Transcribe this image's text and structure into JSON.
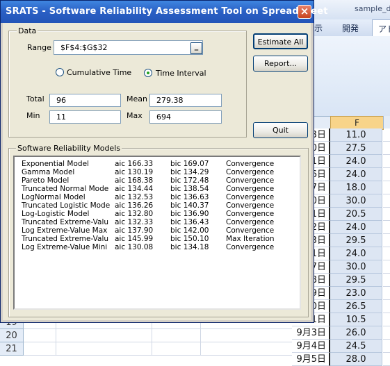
{
  "dialog": {
    "title": "SRATS - Software Reliability Assessment Tool on Spreadsheet",
    "close_glyph": "×",
    "data_group_label": "Data",
    "range_label": "Range",
    "range_value": "$F$4:$G$32",
    "range_button_glyph": "_",
    "radio_cumulative_label": "Cumulative Time",
    "radio_interval_label": "Time Interval",
    "selected_mode": "Time Interval",
    "total_label": "Total",
    "total_value": "96",
    "mean_label": "Mean",
    "mean_value": "279.38",
    "min_label": "Min",
    "min_value": "11",
    "max_label": "Max",
    "max_value": "694",
    "estimate_all_label": "Estimate All",
    "report_label": "Report...",
    "quit_label": "Quit",
    "models_group_label": "Software Reliability Models",
    "models": [
      {
        "name": "Exponential Model",
        "aic": "aic 166.33",
        "bic": "bic 169.07",
        "status": "Convergence"
      },
      {
        "name": "Gamma Model",
        "aic": "aic 130.19",
        "bic": "bic 134.29",
        "status": "Convergence"
      },
      {
        "name": "Pareto Model",
        "aic": "aic 168.38",
        "bic": "bic 172.48",
        "status": "Convergence"
      },
      {
        "name": "Truncated Normal Mode",
        "aic": "aic 134.44",
        "bic": "bic 138.54",
        "status": "Convergence"
      },
      {
        "name": "LogNormal Model",
        "aic": "aic 132.53",
        "bic": "bic 136.63",
        "status": "Convergence"
      },
      {
        "name": "Truncated Logistic Mode",
        "aic": "aic 136.26",
        "bic": "bic 140.37",
        "status": "Convergence"
      },
      {
        "name": "Log-Logistic Model",
        "aic": "aic 132.80",
        "bic": "bic 136.90",
        "status": "Convergence"
      },
      {
        "name": "Truncated Extreme-Valu",
        "aic": "aic 132.33",
        "bic": "bic 136.43",
        "status": "Convergence"
      },
      {
        "name": "Log Extreme-Value Max",
        "aic": "aic 137.90",
        "bic": "bic 142.00",
        "status": "Convergence"
      },
      {
        "name": "Truncated Extreme-Valu",
        "aic": "aic 145.99",
        "bic": "bic 150.10",
        "status": "Max Iteration"
      },
      {
        "name": "Log Extreme-Value Mini",
        "aic": "aic 130.08",
        "bic": "bic 134.18",
        "status": "Convergence"
      }
    ]
  },
  "excel": {
    "title_fragment": "sample_da",
    "ribbon_tabs": [
      "示",
      "開発",
      "アド"
    ],
    "column_f_header": "F",
    "f_values": [
      "11.0",
      "27.5",
      "24.0",
      "24.0",
      "18.0",
      "30.0",
      "20.5",
      "24.0",
      "29.5",
      "24.0",
      "30.0",
      "29.5",
      "23.0",
      "26.5",
      "10.5",
      "26.0",
      "24.5",
      "28.0"
    ],
    "e_values": [
      "3日",
      "0日",
      "1日",
      "6日",
      "7日",
      "0日",
      "1日",
      "2日",
      "3日",
      "1日",
      "7日",
      "8日",
      "9日",
      "0日",
      "1日",
      "9月3日",
      "9月4日",
      "9月5日"
    ],
    "row_numbers": [
      "19",
      "20",
      "21"
    ]
  }
}
